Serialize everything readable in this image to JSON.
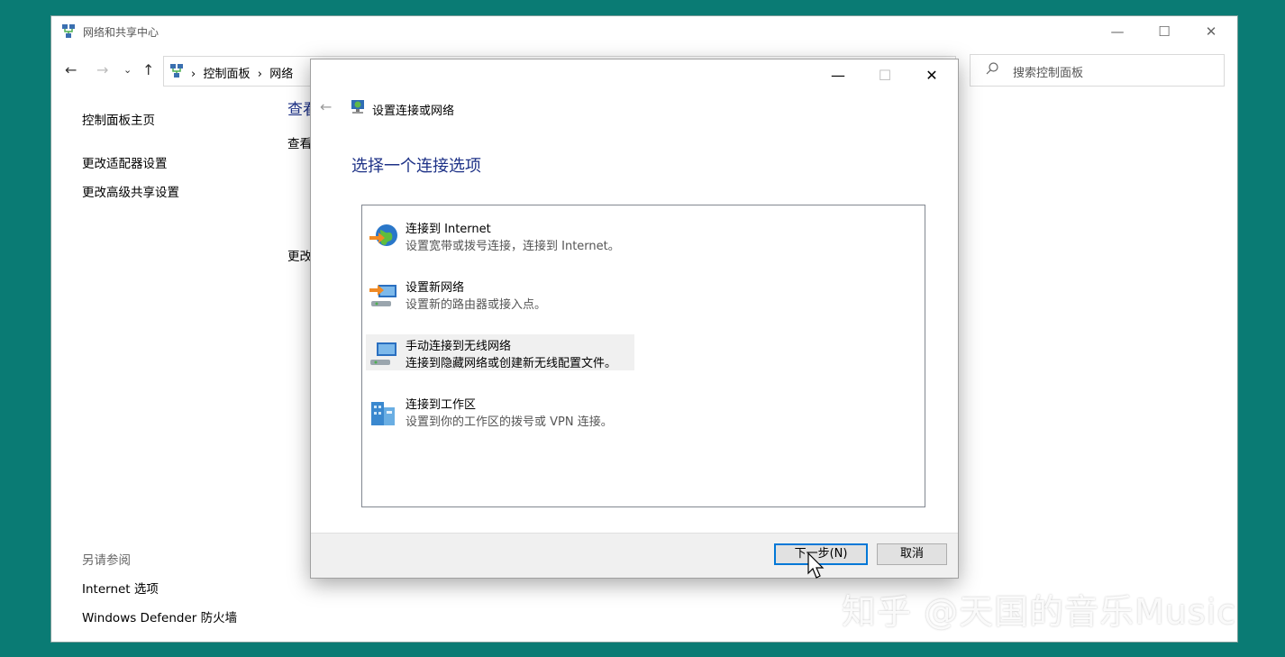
{
  "main_window": {
    "title": "网络和共享中心",
    "controls": {
      "minimize": "—",
      "maximize": "☐",
      "close": "✕"
    },
    "address": {
      "crumb1": "控制面板",
      "crumb2": "网络",
      "sep": "›"
    },
    "search": {
      "placeholder": "搜索控制面板"
    },
    "left_nav": {
      "home": "控制面板主页",
      "items": [
        "更改适配器设置",
        "更改高级共享设置"
      ]
    },
    "see_also": {
      "header": "另请参阅",
      "links": [
        "Internet 选项",
        "Windows Defender 防火墙"
      ]
    },
    "peek": {
      "heading": "查看",
      "line1": "查看",
      "line2": "更改"
    }
  },
  "dialog": {
    "title": "设置连接或网络",
    "heading": "选择一个连接选项",
    "controls": {
      "minimize": "—",
      "maximize": "☐",
      "close": "✕"
    },
    "options": [
      {
        "title": "连接到 Internet",
        "desc": "设置宽带或拨号连接，连接到 Internet。"
      },
      {
        "title": "设置新网络",
        "desc": "设置新的路由器或接入点。"
      },
      {
        "title": "手动连接到无线网络",
        "desc": "连接到隐藏网络或创建新无线配置文件。"
      },
      {
        "title": "连接到工作区",
        "desc": "设置到你的工作区的拨号或 VPN 连接。"
      }
    ],
    "buttons": {
      "next": "下一步(N)",
      "cancel": "取消"
    }
  },
  "watermark": "知乎 @天国的音乐Music",
  "colors": {
    "background": "#0a7b74",
    "heading_blue": "#1e3287",
    "focus_blue": "#0078d7"
  }
}
